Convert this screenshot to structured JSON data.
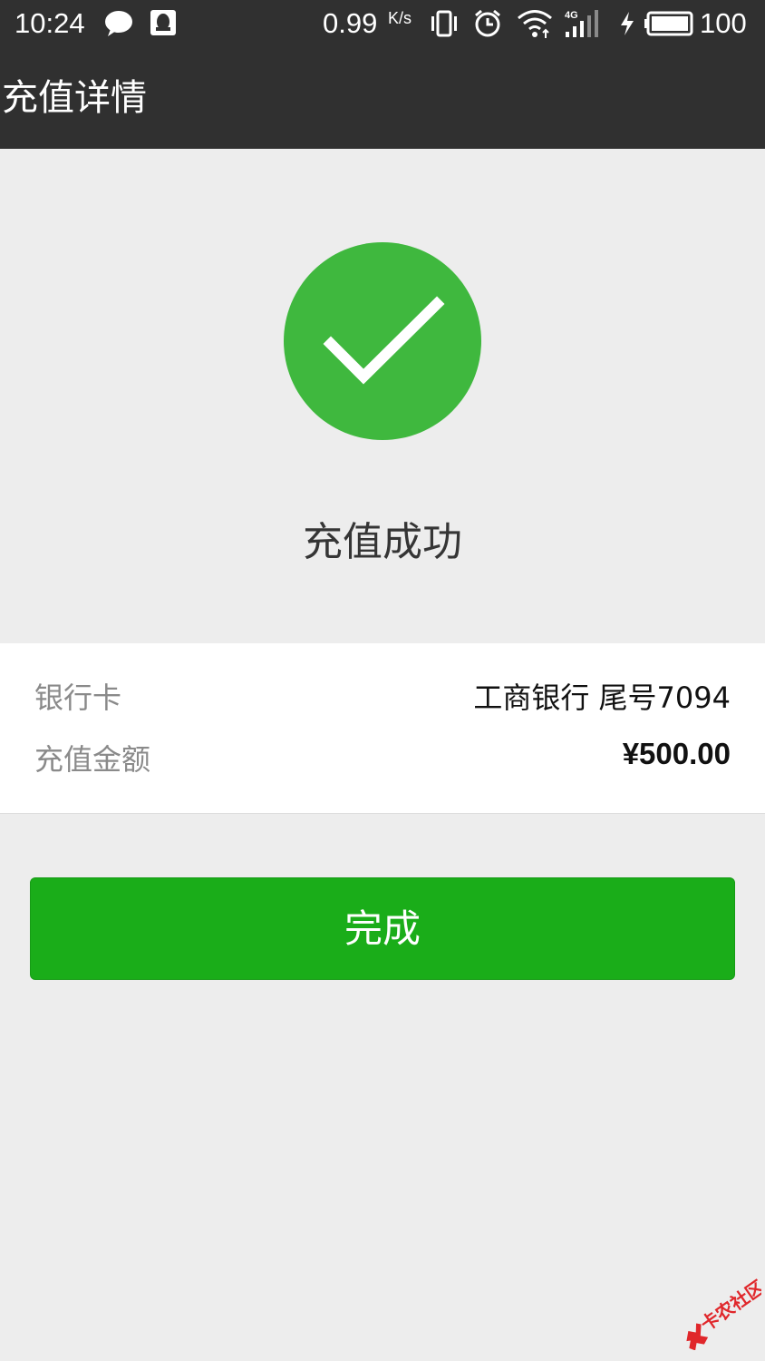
{
  "status_bar": {
    "time": "10:24",
    "network_speed": "0.99",
    "network_speed_unit": "K/s",
    "network_type": "4G",
    "battery": "100"
  },
  "header": {
    "title": "充值详情"
  },
  "result": {
    "icon": "check-icon",
    "status_text": "充值成功",
    "icon_color": "#3fb83e"
  },
  "details": {
    "rows": [
      {
        "label": "银行卡",
        "value": "工商银行 尾号7094"
      },
      {
        "label": "充值金额",
        "value": "¥500.00"
      }
    ]
  },
  "actions": {
    "done_label": "完成",
    "button_color": "#1aad19"
  },
  "watermark": {
    "text": "卡农社区"
  }
}
